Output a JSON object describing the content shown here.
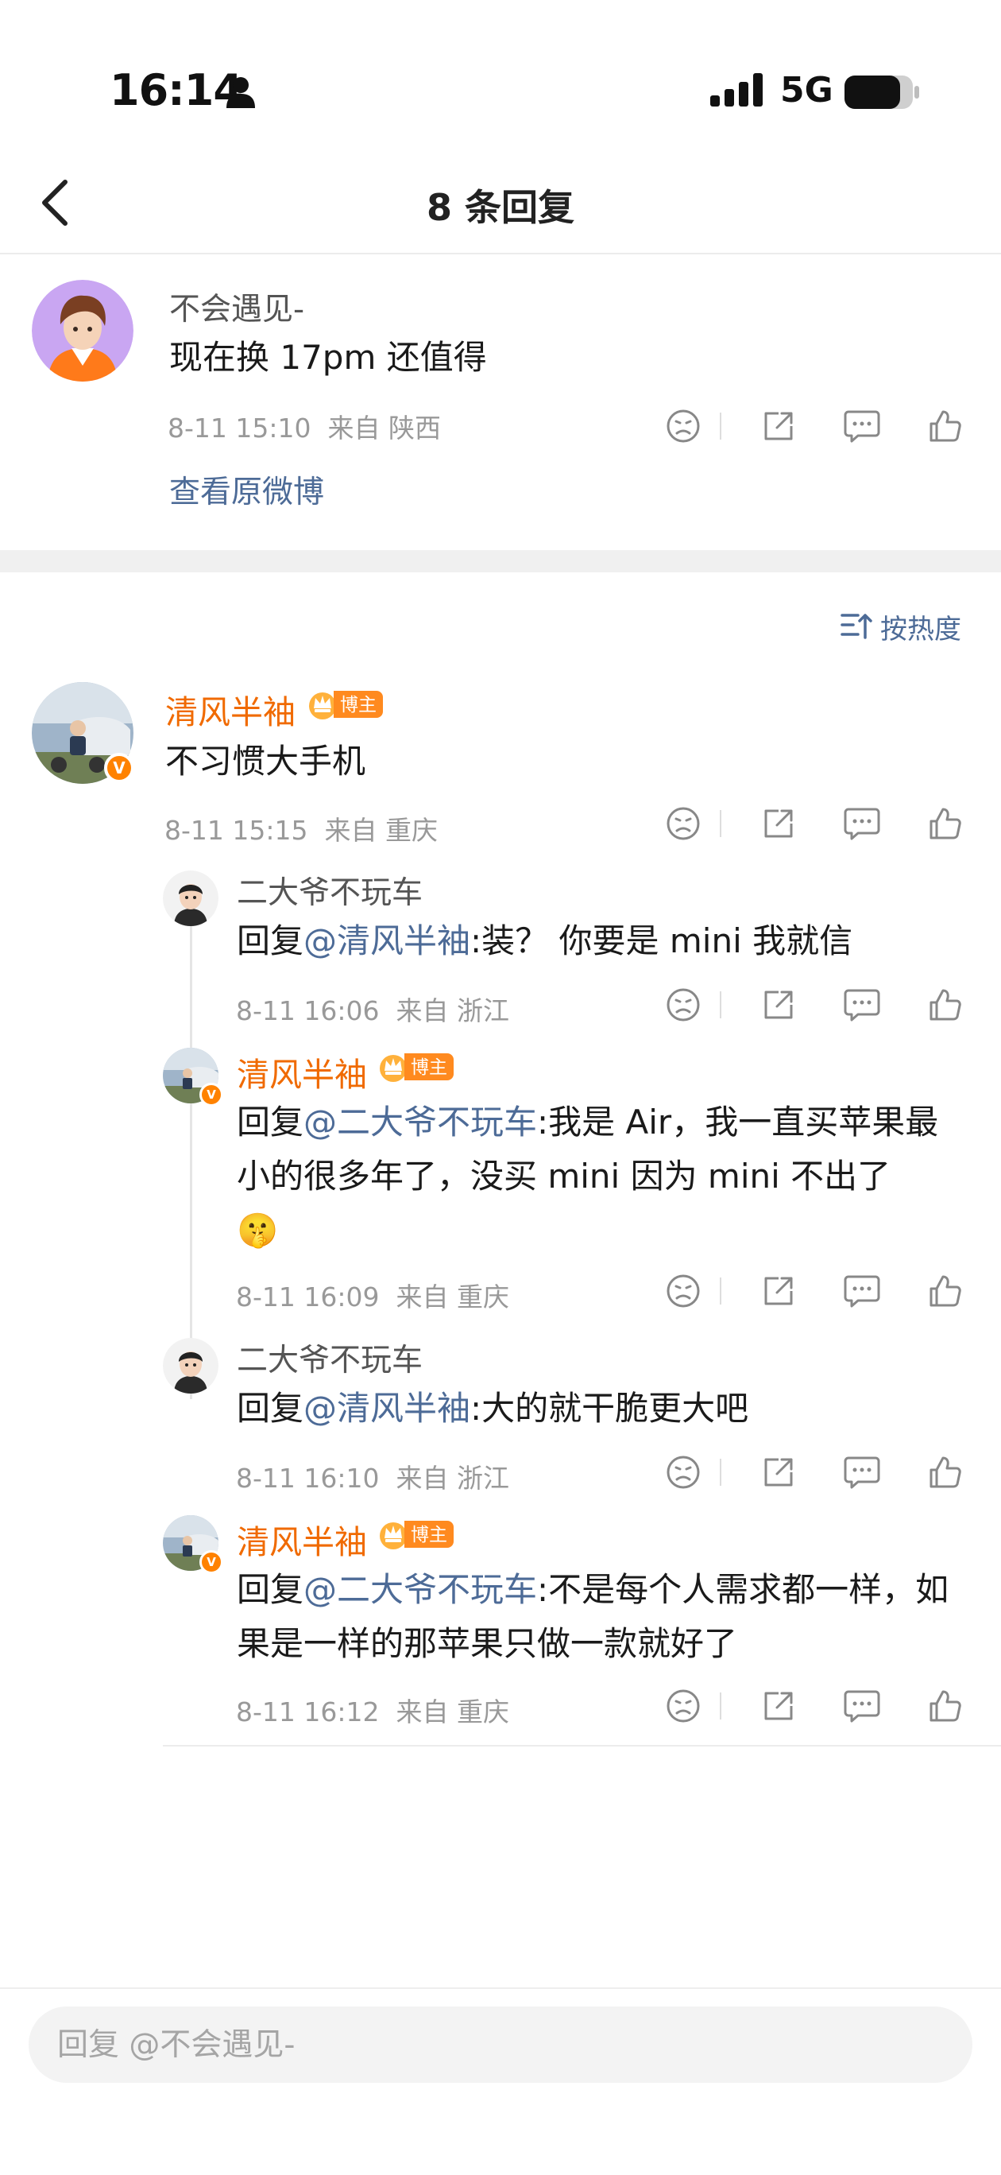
{
  "status_bar": {
    "time": "16:14",
    "network": "5G"
  },
  "nav": {
    "title": "8 条回复"
  },
  "root_comment": {
    "user": "不会遇见-",
    "text": "现在换 17pm 还值得",
    "time": "8-11 15:10",
    "location": "来自 陕西",
    "view_original": "查看原微博"
  },
  "sort": {
    "label": "按热度"
  },
  "main_comment": {
    "user": "清风半袖",
    "badge": "博主",
    "text": "不习惯大手机",
    "time": "8-11 15:15",
    "location": "来自 重庆"
  },
  "replies": [
    {
      "user": "二大爷不玩车",
      "reply_prefix": "回复",
      "mention": "@清风半袖",
      "text": ":装？ 你要是 mini 我就信",
      "time": "8-11 16:06",
      "location": "来自 浙江"
    },
    {
      "user": "清风半袖",
      "badge": "博主",
      "reply_prefix": "回复",
      "mention": "@二大爷不玩车",
      "text": ":我是 Air，我一直买苹果最小的很多年了，没买 mini 因为 mini 不出了",
      "emoji": "🤫",
      "time": "8-11 16:09",
      "location": "来自 重庆"
    },
    {
      "user": "二大爷不玩车",
      "reply_prefix": "回复",
      "mention": "@清风半袖",
      "text": ":大的就干脆更大吧",
      "time": "8-11 16:10",
      "location": "来自 浙江"
    },
    {
      "user": "清风半袖",
      "badge": "博主",
      "reply_prefix": "回复",
      "mention": "@二大爷不玩车",
      "text": ":不是每个人需求都一样，如果是一样的那苹果只做一款就好了",
      "time": "8-11 16:12",
      "location": "来自 重庆"
    }
  ],
  "reply_bar": {
    "placeholder": "回复 @不会遇见-"
  },
  "colors": {
    "link": "#4d6b97",
    "vip_name": "#f06a00",
    "badge": "#ff8a1f",
    "meta": "#999999"
  }
}
